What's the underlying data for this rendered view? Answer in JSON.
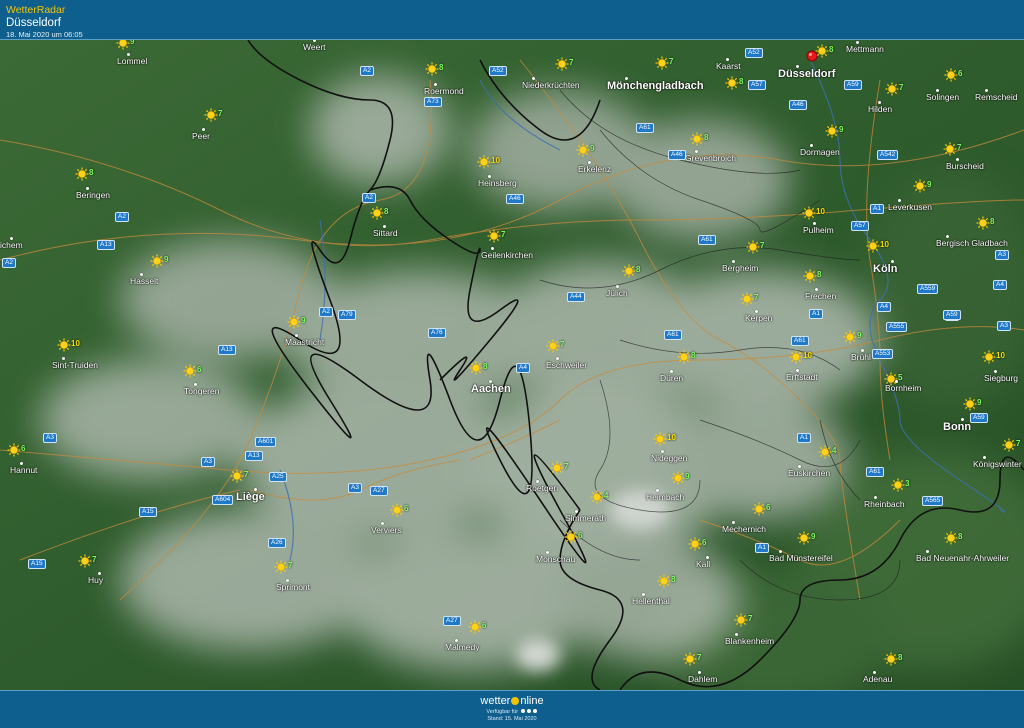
{
  "header": {
    "app_title": "WetterRadar",
    "location": "Düsseldorf",
    "datetime": "18. Mai 2020 um 06:05"
  },
  "colors": {
    "header_bg": "#0e5f8e",
    "accent": "#f4c400",
    "land": "#2f5a2f",
    "cloud": "#c4c9c4",
    "border_line": "#111111",
    "road_line": "#c98a3a",
    "temp_green": "#7cfc5c",
    "temp_yellow": "#f2e000",
    "pin": "#e31b1b"
  },
  "icons": {
    "weather": "sun-icon",
    "location": "map-pin-icon"
  },
  "cities": [
    {
      "name": "Weert",
      "big": false
    },
    {
      "name": "Lommel",
      "big": false
    },
    {
      "name": "Roermond",
      "big": false
    },
    {
      "name": "Niederkrüchten",
      "big": false
    },
    {
      "name": "Mönchengladbach",
      "big": true
    },
    {
      "name": "Kaarst",
      "big": false
    },
    {
      "name": "Düsseldorf",
      "big": true
    },
    {
      "name": "Mettmann",
      "big": false
    },
    {
      "name": "Solingen",
      "big": false
    },
    {
      "name": "Remscheid",
      "big": false
    },
    {
      "name": "Hilden",
      "big": false
    },
    {
      "name": "Peer",
      "big": false
    },
    {
      "name": "Dormagen",
      "big": false
    },
    {
      "name": "Grevenbroich",
      "big": false
    },
    {
      "name": "Burscheid",
      "big": false
    },
    {
      "name": "Beringen",
      "big": false
    },
    {
      "name": "Heinsberg",
      "big": false
    },
    {
      "name": "Erkelenz",
      "big": false
    },
    {
      "name": "Leverkusen",
      "big": false
    },
    {
      "name": "Sittard",
      "big": false
    },
    {
      "name": "Pulheim",
      "big": false
    },
    {
      "name": "Bergisch Gladbach",
      "big": false
    },
    {
      "name": "ichem",
      "big": false
    },
    {
      "name": "Geilenkirchen",
      "big": false
    },
    {
      "name": "Bergheim",
      "big": false
    },
    {
      "name": "Köln",
      "big": true
    },
    {
      "name": "Hasselt",
      "big": false
    },
    {
      "name": "Jülich",
      "big": false
    },
    {
      "name": "Frechen",
      "big": false
    },
    {
      "name": "Kerpen",
      "big": false
    },
    {
      "name": "Maastricht",
      "big": false
    },
    {
      "name": "Brühl",
      "big": false
    },
    {
      "name": "Sint-Truiden",
      "big": false
    },
    {
      "name": "Eschweiler",
      "big": false
    },
    {
      "name": "Düren",
      "big": false
    },
    {
      "name": "Erftstadt",
      "big": false
    },
    {
      "name": "Siegburg",
      "big": false
    },
    {
      "name": "Tongeren",
      "big": false
    },
    {
      "name": "Aachen",
      "big": true
    },
    {
      "name": "Bornheim",
      "big": false
    },
    {
      "name": "Bonn",
      "big": true
    },
    {
      "name": "Hannut",
      "big": false
    },
    {
      "name": "Nideggen",
      "big": false
    },
    {
      "name": "Euskirchen",
      "big": false
    },
    {
      "name": "Königswinter",
      "big": false
    },
    {
      "name": "Liège",
      "big": true
    },
    {
      "name": "Roetgen",
      "big": false
    },
    {
      "name": "Heimbach",
      "big": false
    },
    {
      "name": "Rheinbach",
      "big": false
    },
    {
      "name": "Verviers",
      "big": false
    },
    {
      "name": "Simmerath",
      "big": false
    },
    {
      "name": "Mechernich",
      "big": false
    },
    {
      "name": "Monschau",
      "big": false
    },
    {
      "name": "Bad Münstereifel",
      "big": false
    },
    {
      "name": "Bad Neuenahr-Ahrweiler",
      "big": false
    },
    {
      "name": "Huy",
      "big": false
    },
    {
      "name": "Sprimont",
      "big": false
    },
    {
      "name": "Kall",
      "big": false
    },
    {
      "name": "Hellenthal",
      "big": false
    },
    {
      "name": "Blankenheim",
      "big": false
    },
    {
      "name": "Malmedy",
      "big": false
    },
    {
      "name": "Dahlem",
      "big": false
    },
    {
      "name": "Adenau",
      "big": false
    }
  ],
  "weather_points": [
    {
      "temp": "9",
      "warm": false
    },
    {
      "temp": "8",
      "warm": false
    },
    {
      "temp": "7",
      "warm": false
    },
    {
      "temp": "7",
      "warm": false
    },
    {
      "temp": "8",
      "warm": false
    },
    {
      "temp": "8",
      "warm": false
    },
    {
      "temp": "6",
      "warm": false
    },
    {
      "temp": "7",
      "warm": false
    },
    {
      "temp": "7",
      "warm": false
    },
    {
      "temp": "9",
      "warm": false
    },
    {
      "temp": "8",
      "warm": false
    },
    {
      "temp": "7",
      "warm": false
    },
    {
      "temp": "8",
      "warm": false
    },
    {
      "temp": "9",
      "warm": false
    },
    {
      "temp": "10",
      "warm": true
    },
    {
      "temp": "9",
      "warm": false
    },
    {
      "temp": "8",
      "warm": false
    },
    {
      "temp": "10",
      "warm": true
    },
    {
      "temp": "8",
      "warm": false
    },
    {
      "temp": "7",
      "warm": false
    },
    {
      "temp": "10",
      "warm": true
    },
    {
      "temp": "7",
      "warm": false
    },
    {
      "temp": "9",
      "warm": false
    },
    {
      "temp": "8",
      "warm": false
    },
    {
      "temp": "8",
      "warm": false
    },
    {
      "temp": "7",
      "warm": false
    },
    {
      "temp": "9",
      "warm": false
    },
    {
      "temp": "9",
      "warm": false
    },
    {
      "temp": "10",
      "warm": true
    },
    {
      "temp": "7",
      "warm": false
    },
    {
      "temp": "8",
      "warm": false
    },
    {
      "temp": "6",
      "warm": false
    },
    {
      "temp": "10",
      "warm": true
    },
    {
      "temp": "10",
      "warm": true
    },
    {
      "temp": "8",
      "warm": false
    },
    {
      "temp": "5",
      "warm": false
    },
    {
      "temp": "9",
      "warm": false
    },
    {
      "temp": "7",
      "warm": false
    },
    {
      "temp": "6",
      "warm": false
    },
    {
      "temp": "10",
      "warm": true
    },
    {
      "temp": "4",
      "warm": false
    },
    {
      "temp": "7",
      "warm": false
    },
    {
      "temp": "7",
      "warm": false
    },
    {
      "temp": "9",
      "warm": false
    },
    {
      "temp": "3",
      "warm": false
    },
    {
      "temp": "6",
      "warm": false
    },
    {
      "temp": "4",
      "warm": false
    },
    {
      "temp": "6",
      "warm": false
    },
    {
      "temp": "6",
      "warm": false
    },
    {
      "temp": "9",
      "warm": false
    },
    {
      "temp": "8",
      "warm": false
    },
    {
      "temp": "7",
      "warm": false
    },
    {
      "temp": "7",
      "warm": false
    },
    {
      "temp": "6",
      "warm": false
    },
    {
      "temp": "8",
      "warm": false
    },
    {
      "temp": "7",
      "warm": false
    },
    {
      "temp": "6",
      "warm": false
    },
    {
      "temp": "7",
      "warm": false
    },
    {
      "temp": "8",
      "warm": false
    }
  ],
  "roads": [
    "A2",
    "A52",
    "A52",
    "A57",
    "A73",
    "A46",
    "A59",
    "A61",
    "A46",
    "A542",
    "A2",
    "A2",
    "A46",
    "A13",
    "A1",
    "A57",
    "A61",
    "A3",
    "A2",
    "A4",
    "A44",
    "A2",
    "A79",
    "A61",
    "A559",
    "A4",
    "A1",
    "A4",
    "A59",
    "A555",
    "A3",
    "A76",
    "A13",
    "A61",
    "A553",
    "A4",
    "A59",
    "A3",
    "A601",
    "A13",
    "A3",
    "A1",
    "A61",
    "A604",
    "A25",
    "A3",
    "A27",
    "A565",
    "A15",
    "A26",
    "A1",
    "A15",
    "A27"
  ],
  "footer": {
    "brand_pre": "wetter",
    "brand_post": "nline",
    "availability": "Verfügbar für",
    "stand": "Stand: 15. Mai 2020"
  }
}
